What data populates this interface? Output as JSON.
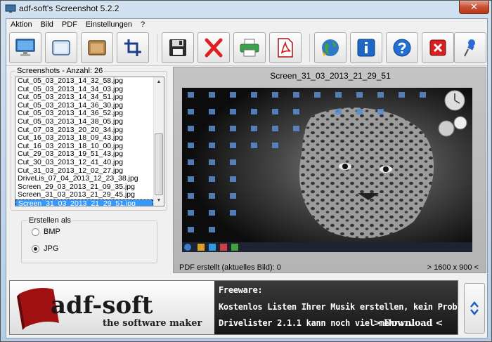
{
  "window": {
    "title": "adf-soft's Screenshot 5.2.2",
    "close_label": "✕"
  },
  "menu": [
    "Aktion",
    "Bild",
    "PDF",
    "Einstellungen",
    "?"
  ],
  "toolbar": [
    {
      "name": "fullscreen-capture-button",
      "icon": "monitor-icon"
    },
    {
      "name": "window-capture-button",
      "icon": "window-icon"
    },
    {
      "name": "area-capture-button",
      "icon": "folder-icon"
    },
    {
      "name": "crop-button",
      "icon": "crop-icon"
    },
    {
      "name": "save-button",
      "icon": "floppy-icon"
    },
    {
      "name": "delete-button",
      "icon": "red-x-icon"
    },
    {
      "name": "print-button",
      "icon": "printer-icon"
    },
    {
      "name": "pdf-button",
      "icon": "pdf-icon"
    },
    {
      "name": "web-button",
      "icon": "globe-icon"
    },
    {
      "name": "info-button",
      "icon": "info-icon"
    },
    {
      "name": "help-button",
      "icon": "question-icon"
    },
    {
      "name": "exit-button",
      "icon": "exit-icon"
    },
    {
      "name": "pin-button",
      "icon": "pin-icon"
    }
  ],
  "screenshots": {
    "label": "Screenshots - Anzahl: 26",
    "items": [
      "Cut_05_03_2013_14_32_58.jpg",
      "Cut_05_03_2013_14_34_03.jpg",
      "Cut_05_03_2013_14_34_51.jpg",
      "Cut_05_03_2013_14_36_30.jpg",
      "Cut_05_03_2013_14_36_52.jpg",
      "Cut_05_03_2013_14_38_05.jpg",
      "Cut_07_03_2013_20_20_34.jpg",
      "Cut_16_03_2013_18_09_43.jpg",
      "Cut_16_03_2013_18_10_00.jpg",
      "Cut_29_03_2013_19_51_43.jpg",
      "Cut_30_03_2013_12_41_40.jpg",
      "Cut_31_03_2013_12_02_27.jpg",
      "DriveLis_07_04_2013_12_23_38.jpg",
      "Screen_29_03_2013_21_09_35.jpg",
      "Screen_31_03_2013_21_29_45.jpg",
      "Screen_31_03_2013_21_29_51.jpg"
    ],
    "selected_index": 15
  },
  "create_as": {
    "label": "Erstellen als",
    "options": [
      "BMP",
      "JPG"
    ],
    "selected": "JPG"
  },
  "preview": {
    "title": "Screen_31_03_2013_21_29_51",
    "status_left": "PDF erstellt (aktuelles Bild):  0",
    "status_right": "> 1600 x 900 <"
  },
  "banner": {
    "logo_text": "adf-soft",
    "logo_tagline": "the software maker",
    "line1": "Freeware:",
    "line2": "Kostenlos Listen Ihrer Musik erstellen, kein Problem.",
    "line3": "Drivelister 2.1.1 kann noch viel mehr...",
    "download": "> Download <"
  },
  "colors": {
    "selection": "#3399ff",
    "close_red": "#c75030",
    "logo_red": "#a01010"
  }
}
